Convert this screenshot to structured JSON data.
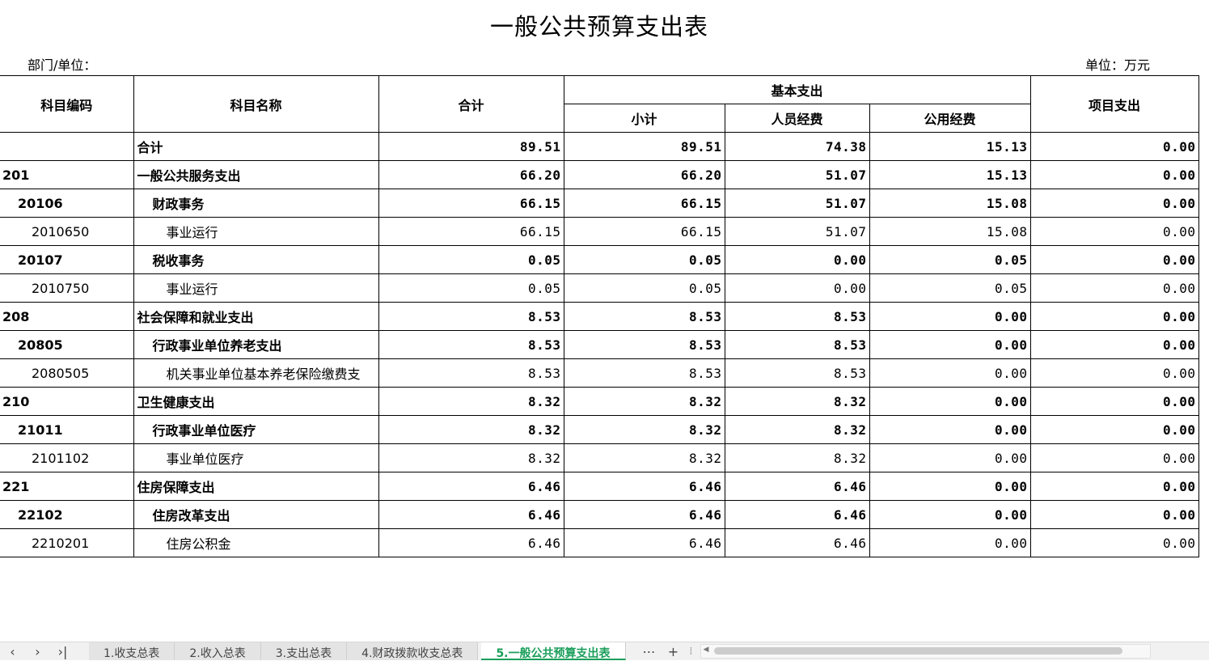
{
  "title": "一般公共预算支出表",
  "dept_label": "部门/单位：",
  "unit_label": "单位：万元",
  "headers": {
    "code": "科目编码",
    "name": "科目名称",
    "total": "合计",
    "basic": "基本支出",
    "subtotal": "小计",
    "personnel": "人员经费",
    "public": "公用经费",
    "project": "项目支出"
  },
  "rows": [
    {
      "level": 0,
      "code": "",
      "name": "合计",
      "total": "89.51",
      "subtotal": "89.51",
      "personnel": "74.38",
      "public": "15.13",
      "project": "0.00"
    },
    {
      "level": 0,
      "code": "201",
      "name": "一般公共服务支出",
      "total": "66.20",
      "subtotal": "66.20",
      "personnel": "51.07",
      "public": "15.13",
      "project": "0.00"
    },
    {
      "level": 1,
      "code": "20106",
      "name": "财政事务",
      "total": "66.15",
      "subtotal": "66.15",
      "personnel": "51.07",
      "public": "15.08",
      "project": "0.00"
    },
    {
      "level": 2,
      "code": "2010650",
      "name": "事业运行",
      "total": "66.15",
      "subtotal": "66.15",
      "personnel": "51.07",
      "public": "15.08",
      "project": "0.00"
    },
    {
      "level": 1,
      "code": "20107",
      "name": "税收事务",
      "total": "0.05",
      "subtotal": "0.05",
      "personnel": "0.00",
      "public": "0.05",
      "project": "0.00"
    },
    {
      "level": 2,
      "code": "2010750",
      "name": "事业运行",
      "total": "0.05",
      "subtotal": "0.05",
      "personnel": "0.00",
      "public": "0.05",
      "project": "0.00"
    },
    {
      "level": 0,
      "code": "208",
      "name": "社会保障和就业支出",
      "total": "8.53",
      "subtotal": "8.53",
      "personnel": "8.53",
      "public": "0.00",
      "project": "0.00"
    },
    {
      "level": 1,
      "code": "20805",
      "name": "行政事业单位养老支出",
      "total": "8.53",
      "subtotal": "8.53",
      "personnel": "8.53",
      "public": "0.00",
      "project": "0.00"
    },
    {
      "level": 2,
      "code": "2080505",
      "name": "机关事业单位基本养老保险缴费支",
      "total": "8.53",
      "subtotal": "8.53",
      "personnel": "8.53",
      "public": "0.00",
      "project": "0.00"
    },
    {
      "level": 0,
      "code": "210",
      "name": "卫生健康支出",
      "total": "8.32",
      "subtotal": "8.32",
      "personnel": "8.32",
      "public": "0.00",
      "project": "0.00"
    },
    {
      "level": 1,
      "code": "21011",
      "name": "行政事业单位医疗",
      "total": "8.32",
      "subtotal": "8.32",
      "personnel": "8.32",
      "public": "0.00",
      "project": "0.00"
    },
    {
      "level": 2,
      "code": "2101102",
      "name": "事业单位医疗",
      "total": "8.32",
      "subtotal": "8.32",
      "personnel": "8.32",
      "public": "0.00",
      "project": "0.00"
    },
    {
      "level": 0,
      "code": "221",
      "name": "住房保障支出",
      "total": "6.46",
      "subtotal": "6.46",
      "personnel": "6.46",
      "public": "0.00",
      "project": "0.00"
    },
    {
      "level": 1,
      "code": "22102",
      "name": "住房改革支出",
      "total": "6.46",
      "subtotal": "6.46",
      "personnel": "6.46",
      "public": "0.00",
      "project": "0.00"
    },
    {
      "level": 2,
      "code": "2210201",
      "name": "住房公积金",
      "total": "6.46",
      "subtotal": "6.46",
      "personnel": "6.46",
      "public": "0.00",
      "project": "0.00"
    }
  ],
  "tabbar": {
    "nav_first": "‹",
    "nav_next": "›",
    "nav_last": "›|",
    "tabs": [
      "1.收支总表",
      "2.收入总表",
      "3.支出总表",
      "4.财政拨款收支总表",
      "5.一般公共预算支出表"
    ],
    "active_tab": 4,
    "more": "⋯",
    "add": "+",
    "separator": "⁞"
  },
  "colors": {
    "active_tab_text": "#1a9e5a",
    "tabbar_bg": "#f1f1f1",
    "grid": "#000000"
  }
}
